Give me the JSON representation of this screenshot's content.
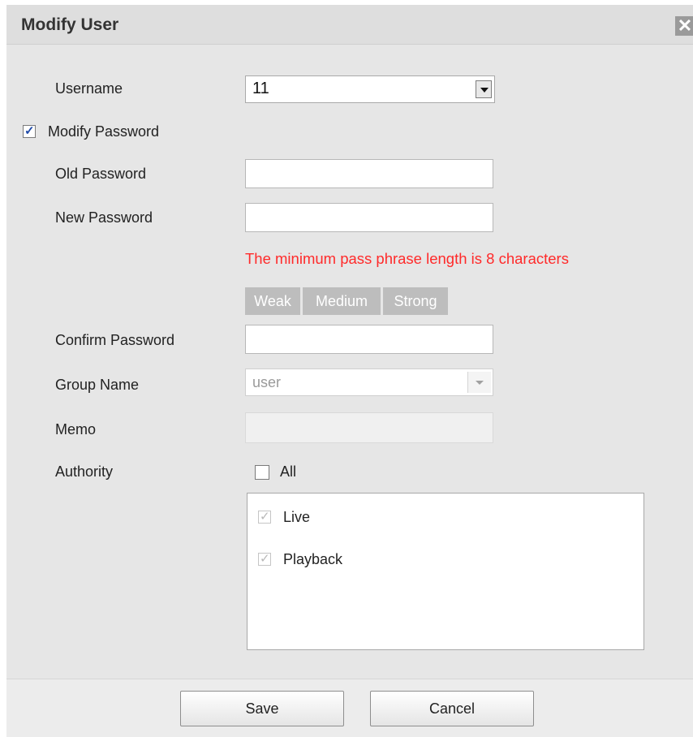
{
  "dialog": {
    "title": "Modify User",
    "close_icon": "close-icon"
  },
  "form": {
    "username_label": "Username",
    "username_value": "11",
    "modify_password_label": "Modify Password",
    "modify_password_checked": true,
    "old_password_label": "Old Password",
    "old_password_value": "",
    "new_password_label": "New Password",
    "new_password_value": "",
    "password_hint": "The minimum pass phrase length is 8 characters",
    "strength": [
      "Weak",
      "Medium",
      "Strong"
    ],
    "confirm_password_label": "Confirm Password",
    "confirm_password_value": "",
    "group_name_label": "Group Name",
    "group_name_value": "user",
    "memo_label": "Memo",
    "memo_value": "",
    "authority_label": "Authority",
    "all_label": "All",
    "authority_items": [
      {
        "label": "Live",
        "checked": true
      },
      {
        "label": "Playback",
        "checked": true
      }
    ]
  },
  "footer": {
    "save_label": "Save",
    "cancel_label": "Cancel"
  },
  "colors": {
    "warning": "#ff2a2a",
    "checkbox_check": "#1f4aa8"
  }
}
